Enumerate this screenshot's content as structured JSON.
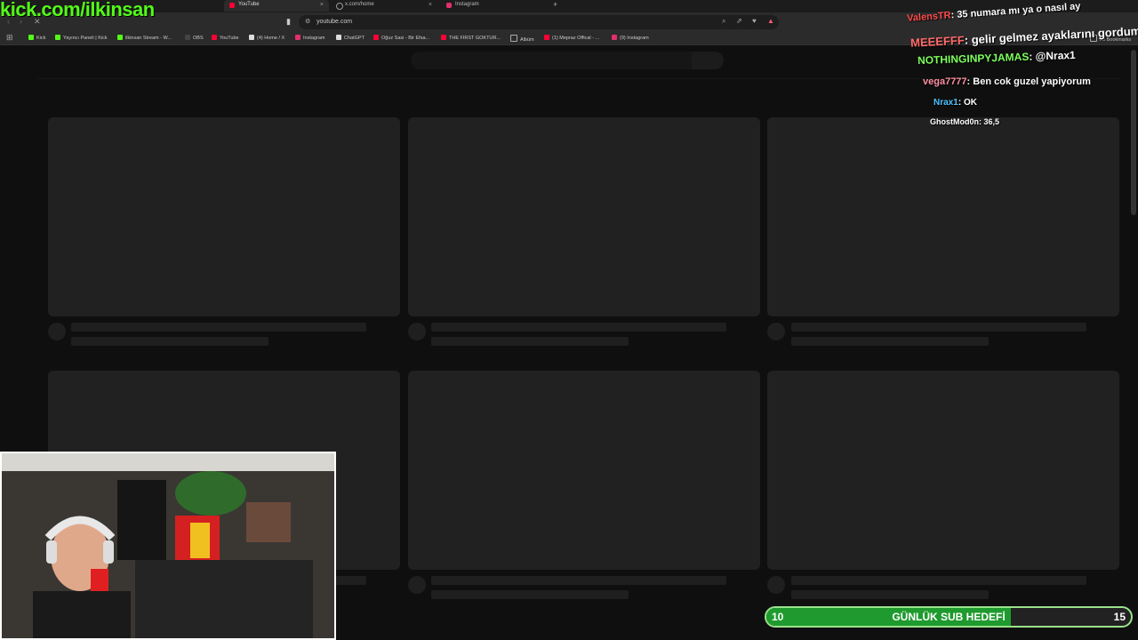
{
  "browser": {
    "tabs": [
      {
        "label": "YouTube",
        "active": true,
        "favicon_color": "#ff0033"
      },
      {
        "label": "x.com/home",
        "active": false,
        "favicon_color": "#999999"
      },
      {
        "label": "Instagram",
        "active": false,
        "favicon_color": "#e1306c"
      }
    ],
    "new_tab": "+",
    "close_tab": "×",
    "url": "youtube.com",
    "all_bookmarks": "All Bookmarks",
    "bookmarks": [
      {
        "label": "Kick",
        "color": "#53fc18"
      },
      {
        "label": "Yayıncı Paneli | Kick",
        "color": "#53fc18"
      },
      {
        "label": "ilkinsan Stream - W...",
        "color": "#53fc18"
      },
      {
        "label": "OBS",
        "color": "#444444"
      },
      {
        "label": "YouTube",
        "color": "#ff0033"
      },
      {
        "label": "(4) Home / X",
        "color": "#dddddd"
      },
      {
        "label": "Instagram",
        "color": "#e1306c"
      },
      {
        "label": "ChatGPT",
        "color": "#dddddd"
      },
      {
        "label": "Oğuz Sasi - Bir Efsa...",
        "color": "#ff0033"
      },
      {
        "label": "THE FIRST GOKTUR...",
        "color": "#ff0033"
      },
      {
        "label": "Albüm",
        "color": "#aaaaaa"
      },
      {
        "label": "(1) Mepraz Offical - ...",
        "color": "#ff0033"
      },
      {
        "label": "(9) Instagram",
        "color": "#e1306c"
      }
    ]
  },
  "overlay": {
    "kick_url": "kick.com/ilkinsan",
    "chat": [
      {
        "user": "ValensTR",
        "sep": ":",
        "message": "35 numara mı ya o nasıl ay",
        "user_color": "#ff4d4d"
      },
      {
        "user": "MEEEFFF",
        "sep": ":",
        "message": "gelir gelmez ayaklarını gordum",
        "user_color": "#ff6b6b"
      },
      {
        "user": "NOTHINGINPYJAMAS",
        "sep": ":",
        "message": "@Nrax1",
        "user_color": "#7cff5c"
      },
      {
        "user": "vega7777",
        "sep": ":",
        "message": "Ben cok guzel yapiyorum",
        "user_color": "#ff8fa3"
      },
      {
        "user": "Nrax1",
        "sep": ":",
        "message": "OK",
        "user_color": "#4fc3ff"
      },
      {
        "user": "GhostMod0n",
        "sep": ":",
        "message": "36,5",
        "user_color": "#ffffff"
      }
    ],
    "sub_goal": {
      "start": "10",
      "label": "GÜNLÜK SUB HEDEFİ",
      "end": "15",
      "progress": 0.67,
      "fill_color": "#1f9a2e"
    }
  }
}
